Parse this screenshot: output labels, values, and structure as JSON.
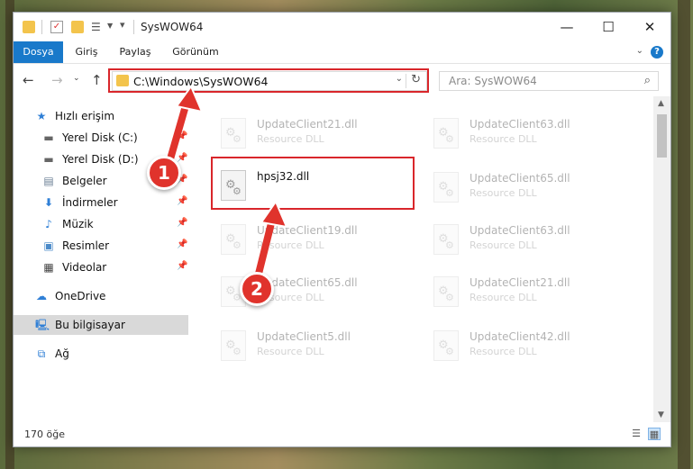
{
  "window": {
    "title": "SysWOW64",
    "minimize_glyph": "—",
    "maximize_glyph": "☐",
    "close_glyph": "✕"
  },
  "ribbon": {
    "tabs": [
      {
        "label": "Dosya",
        "active": true
      },
      {
        "label": "Giriş",
        "active": false
      },
      {
        "label": "Paylaş",
        "active": false
      },
      {
        "label": "Görünüm",
        "active": false
      }
    ],
    "help_glyph": "?"
  },
  "nav": {
    "address": "C:\\Windows\\SysWOW64",
    "search_placeholder": "Ara: SysWOW64"
  },
  "sidebar": {
    "items": [
      {
        "label": "Hızlı erişim",
        "icon": "star-icon",
        "pinned": false
      },
      {
        "label": "Yerel Disk (C:)",
        "icon": "drive-icon",
        "pinned": true
      },
      {
        "label": "Yerel Disk (D:)",
        "icon": "drive-icon",
        "pinned": true
      },
      {
        "label": "Belgeler",
        "icon": "documents-icon",
        "pinned": true
      },
      {
        "label": "İndirmeler",
        "icon": "download-icon",
        "pinned": true
      },
      {
        "label": "Müzik",
        "icon": "music-icon",
        "pinned": true
      },
      {
        "label": "Resimler",
        "icon": "pictures-icon",
        "pinned": true
      },
      {
        "label": "Videolar",
        "icon": "videos-icon",
        "pinned": true
      },
      {
        "label": "OneDrive",
        "icon": "cloud-icon",
        "pinned": false
      },
      {
        "label": "Bu bilgisayar",
        "icon": "computer-icon",
        "pinned": false,
        "selected": true
      },
      {
        "label": "Ağ",
        "icon": "network-icon",
        "pinned": false
      }
    ]
  },
  "files": {
    "highlighted": {
      "name": "hpsj32.dll",
      "type": ""
    },
    "faded_left": [
      {
        "name": "UpdateClient21.dll",
        "type": "Resource DLL"
      },
      {
        "name": "UpdateClient19.dll",
        "type": "Resource DLL"
      },
      {
        "name": "UpdateClient65.dll",
        "type": "Resource DLL"
      },
      {
        "name": "UpdateClient5.dll",
        "type": "Resource DLL"
      }
    ],
    "faded_right": [
      {
        "name": "UpdateClient63.dll",
        "type": "Resource DLL"
      },
      {
        "name": "UpdateClient65.dll",
        "type": "Resource DLL"
      },
      {
        "name": "UpdateClient63.dll",
        "type": "Resource DLL"
      },
      {
        "name": "UpdateClient21.dll",
        "type": "Resource DLL"
      },
      {
        "name": "UpdateClient42.dll",
        "type": "Resource DLL"
      }
    ]
  },
  "status": {
    "item_count": "170 öğe"
  },
  "callouts": {
    "one": "1",
    "two": "2"
  },
  "colors": {
    "accent": "#1979ca",
    "highlight": "#d9262b"
  }
}
